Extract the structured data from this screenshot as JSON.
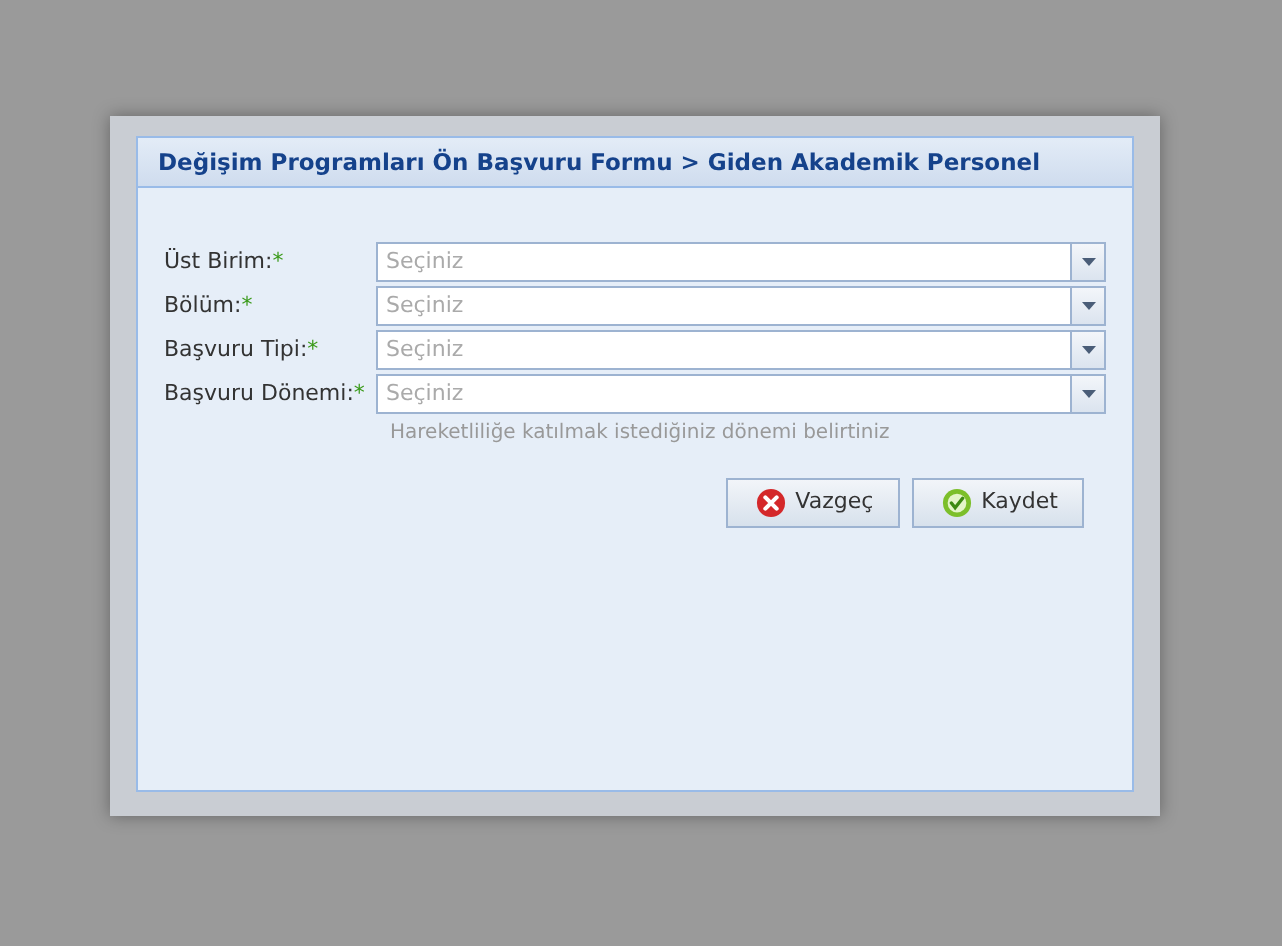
{
  "dialog": {
    "title": "Değişim Programları Ön Başvuru Formu > Giden Akademik Personel"
  },
  "fields": [
    {
      "label": "Üst Birim:",
      "required_mark": "*",
      "placeholder": "Seçiniz"
    },
    {
      "label": "Bölüm:",
      "required_mark": "*",
      "placeholder": "Seçiniz"
    },
    {
      "label": "Başvuru Tipi:",
      "required_mark": "*",
      "placeholder": "Seçiniz"
    },
    {
      "label": "Başvuru Dönemi:",
      "required_mark": "*",
      "placeholder": "Seçiniz",
      "hint": "Hareketliliğe katılmak istediğiniz dönemi belirtiniz"
    }
  ],
  "buttons": [
    {
      "kind": "cancel",
      "label": "Vazgeç"
    },
    {
      "kind": "save",
      "label": "Kaydet"
    }
  ]
}
